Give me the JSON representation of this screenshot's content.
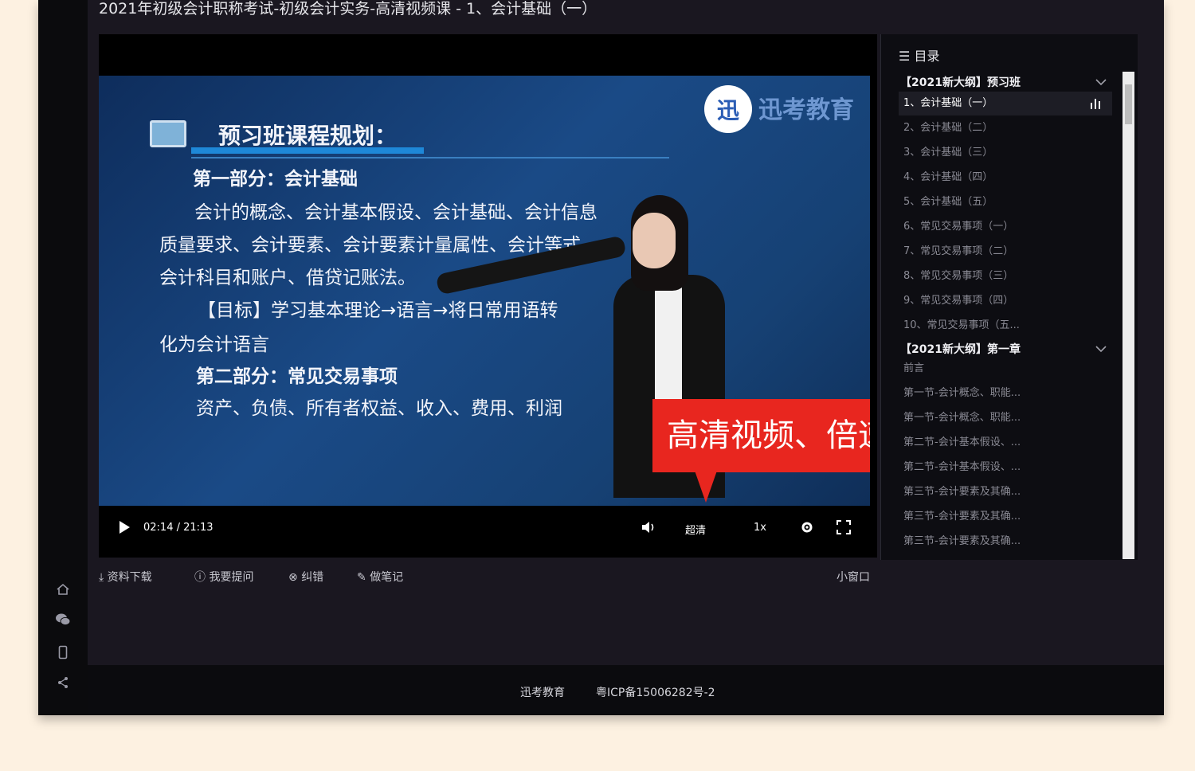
{
  "window": {
    "title": "2021年初级会计职称考试-初级会计实务-高清视频课 - 1、会计基础（一）"
  },
  "rail": {
    "icons": [
      "home-icon",
      "wechat-icon",
      "mobile-icon",
      "share-icon"
    ]
  },
  "video": {
    "slide": {
      "heading": "预习班课程规划：",
      "part1_title": "第一部分：会计基础",
      "part1_lines": [
        "会计的概念、会计基本假设、会计基础、会计信息",
        "质量要求、会计要素、会计要素计量属性、会计等式、",
        "会计科目和账户、借贷记账法。",
        "【目标】学习基本理论→语言→将日常用语转",
        "化为会计语言"
      ],
      "part2_title": "第二部分：常见交易事项",
      "part2_line": "资产、负债、所有者权益、收入、费用、利润"
    },
    "brand": "迅考教育",
    "callout": "高清视频、倍速播放",
    "progress": 0.105
  },
  "controls": {
    "time": "02:14 / 21:13",
    "quality": "超清",
    "speed": "1x"
  },
  "toc": {
    "header": "目录",
    "sections": [
      {
        "title": "【2021新大纲】预习班",
        "items": [
          "1、会计基础（一）",
          "2、会计基础（二）",
          "3、会计基础（三）",
          "4、会计基础（四）",
          "5、会计基础（五）",
          "6、常见交易事项（一）",
          "7、常见交易事项（二）",
          "8、常见交易事项（三）",
          "9、常见交易事项（四）",
          "10、常见交易事项（五..."
        ]
      },
      {
        "title": "【2021新大纲】第一章",
        "items": [
          "前言",
          "第一节-会计概念、职能...",
          "第一节-会计概念、职能...",
          "第二节-会计基本假设、...",
          "第二节-会计基本假设、...",
          "第三节-会计要素及其确...",
          "第三节-会计要素及其确...",
          "第三节-会计要素及其确..."
        ]
      }
    ]
  },
  "actions": {
    "download": "资料下载",
    "ask": "我要提问",
    "correct": "纠错",
    "notes": "做笔记",
    "mini_window": "小窗口"
  },
  "footer": {
    "brand": "迅考教育",
    "icp": "粤ICP备15006282号-2"
  },
  "colors": {
    "page_bg": "#fdf1e1",
    "window_bg": "#1a1720",
    "callout": "#e8261f",
    "progress": "#38b24a"
  }
}
